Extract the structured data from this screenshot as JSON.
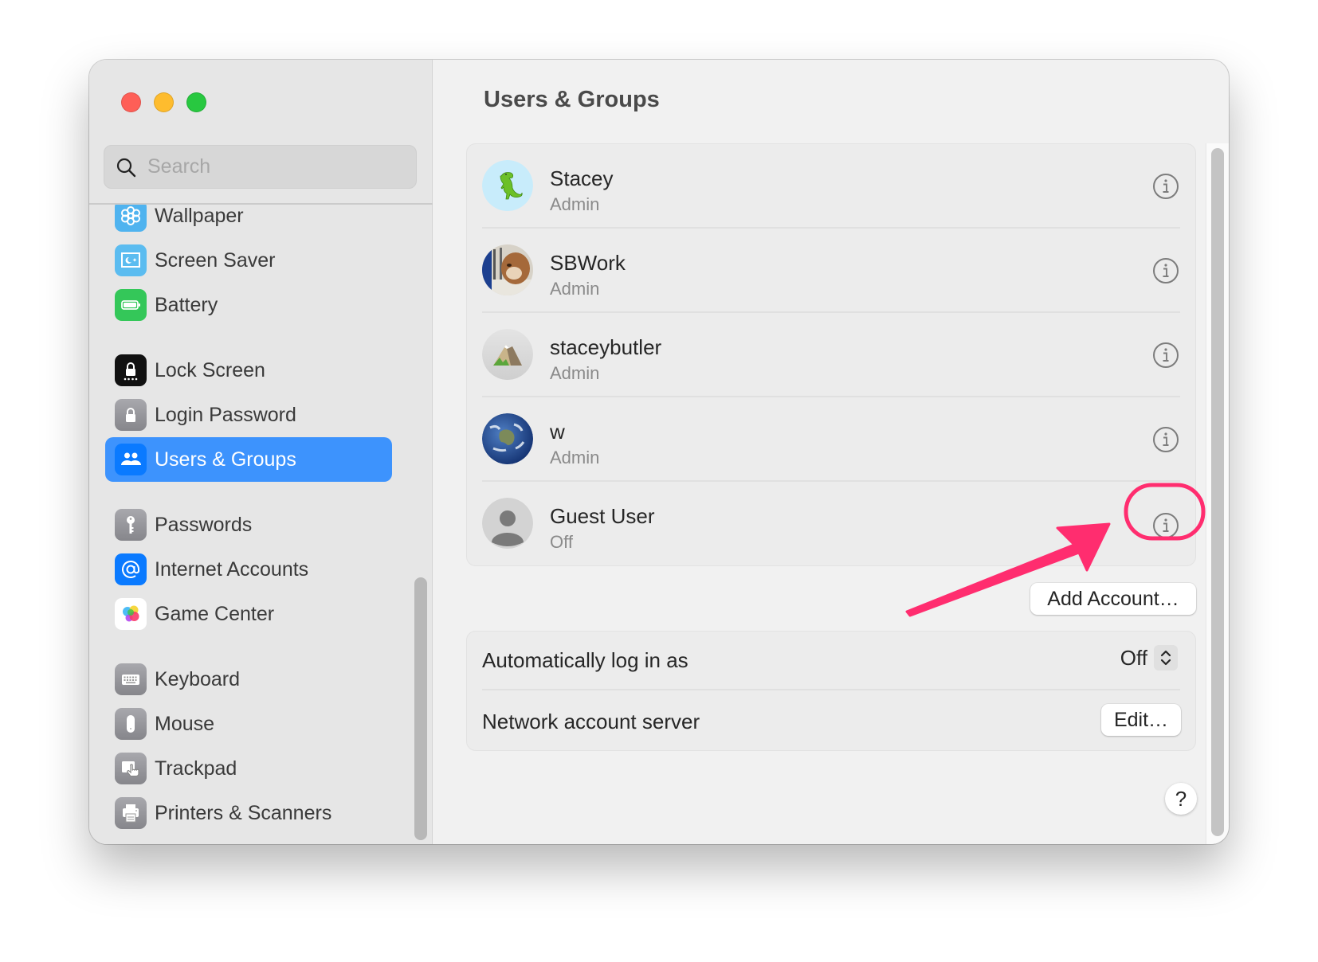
{
  "window": {
    "traffic_lights": [
      "close",
      "minimize",
      "zoom"
    ]
  },
  "sidebar": {
    "search": {
      "placeholder": "Search",
      "value": ""
    },
    "items": [
      {
        "label": "Wallpaper",
        "icon": "wallpaper-icon",
        "color": "#4fb3ef"
      },
      {
        "label": "Screen Saver",
        "icon": "screen-saver-icon",
        "color": "#5bbcf0"
      },
      {
        "label": "Battery",
        "icon": "battery-icon",
        "color": "#34c759"
      },
      {
        "label": "Lock Screen",
        "icon": "lock-screen-icon",
        "color": "#111111"
      },
      {
        "label": "Login Password",
        "icon": "lock-icon",
        "color": "#8e8e93"
      },
      {
        "label": "Users & Groups",
        "icon": "users-icon",
        "color": "#0a7aff",
        "selected": true
      },
      {
        "label": "Passwords",
        "icon": "key-icon",
        "color": "#8e8e93"
      },
      {
        "label": "Internet Accounts",
        "icon": "at-icon",
        "color": "#0a7aff"
      },
      {
        "label": "Game Center",
        "icon": "game-center-icon",
        "color": "#ffffff"
      },
      {
        "label": "Keyboard",
        "icon": "keyboard-icon",
        "color": "#8e8e93"
      },
      {
        "label": "Mouse",
        "icon": "mouse-icon",
        "color": "#8e8e93"
      },
      {
        "label": "Trackpad",
        "icon": "trackpad-icon",
        "color": "#8e8e93"
      },
      {
        "label": "Printers & Scanners",
        "icon": "printer-icon",
        "color": "#8e8e93"
      }
    ],
    "selected_color": "#3d93fd"
  },
  "main": {
    "title": "Users & Groups",
    "users": [
      {
        "name": "Stacey",
        "role": "Admin",
        "avatar": "dinosaur-avatar"
      },
      {
        "name": "SBWork",
        "role": "Admin",
        "avatar": "dog-photo-avatar"
      },
      {
        "name": "staceybutler",
        "role": "Admin",
        "avatar": "mountain-avatar"
      },
      {
        "name": "w",
        "role": "Admin",
        "avatar": "earth-avatar"
      },
      {
        "name": "Guest User",
        "role": "Off",
        "avatar": "generic-person-avatar"
      }
    ],
    "add_account_label": "Add Account…",
    "settings": {
      "auto_login_label": "Automatically log in as",
      "auto_login_value": "Off",
      "network_server_label": "Network account server",
      "edit_label": "Edit…"
    },
    "help_label": "?"
  },
  "annotation": {
    "color": "#ff2d6f",
    "target": "Guest User info button"
  }
}
